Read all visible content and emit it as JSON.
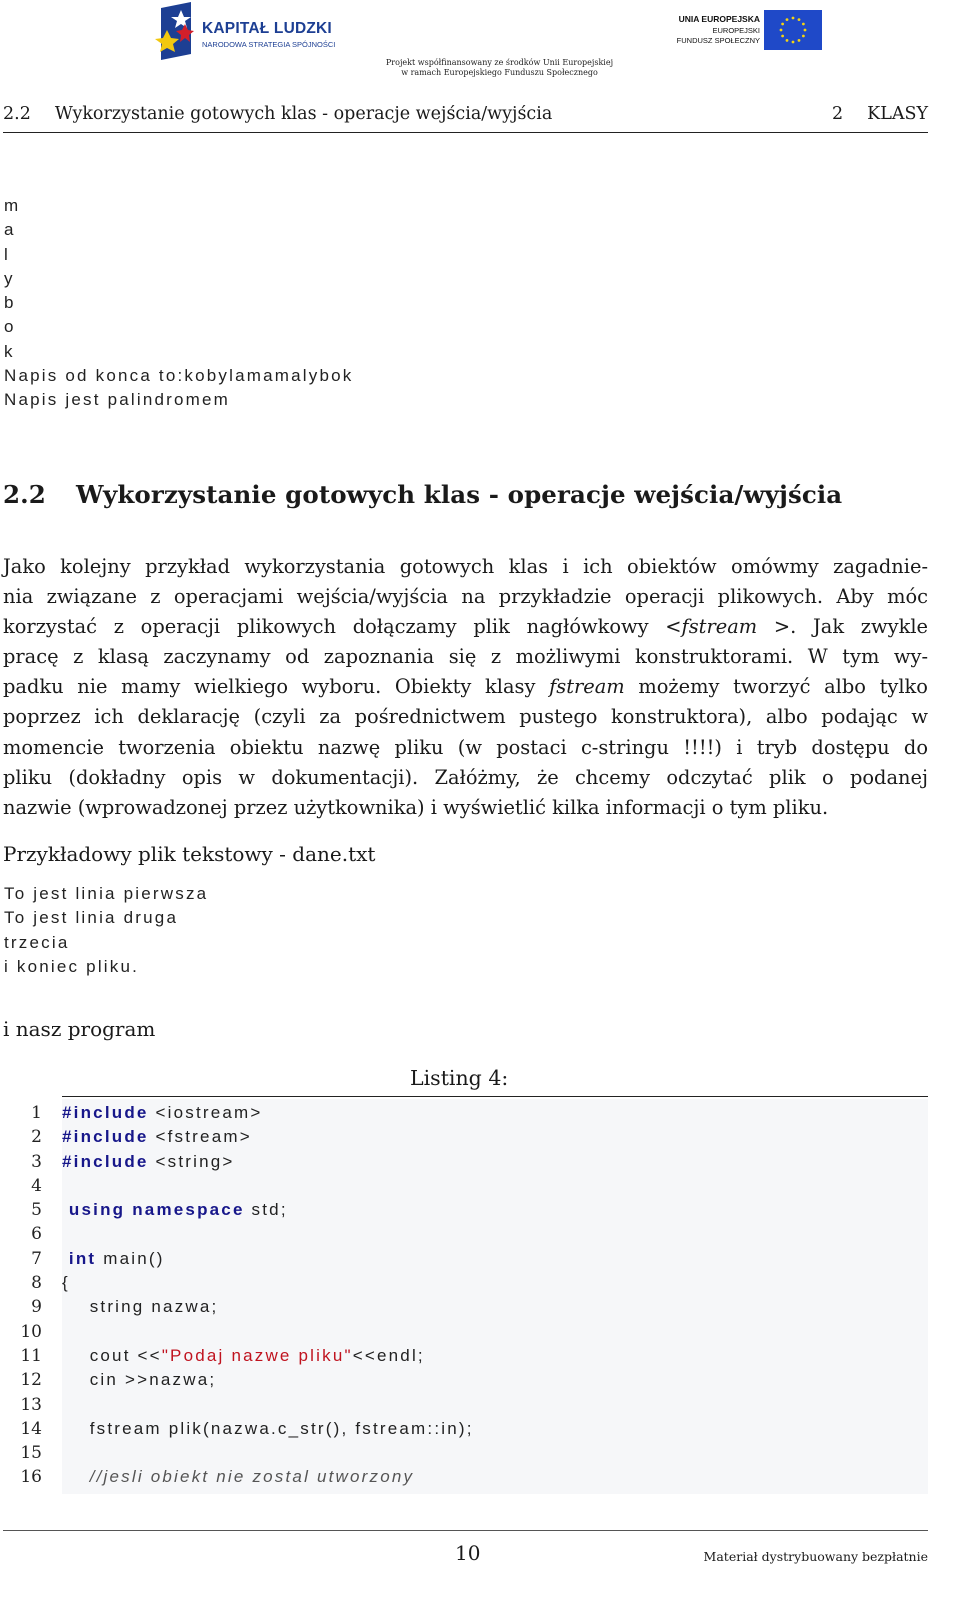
{
  "header": {
    "logo_left": {
      "title": "KAPITAŁ LUDZKI",
      "subtitle": "NARODOWA STRATEGIA SPÓJNOŚCI",
      "colors": {
        "blue": "#1d3f93",
        "white_star": "#ffffff",
        "red_star": "#d21f2a",
        "yellow_star": "#f2c80f"
      }
    },
    "logo_right": {
      "line1": "UNIA EUROPEJSKA",
      "line2": "EUROPEJSKI",
      "line3": "FUNDUSZ SPOŁECZNY",
      "flag_color": "#1f49c8",
      "star_color": "#f4d313"
    },
    "cofinancing": [
      "Projekt współfinansowany ze środków Unii Europejskiej",
      "w ramach Europejskiego Funduszu Społecznego"
    ]
  },
  "running_header": {
    "section_number": "2.2",
    "section_title": "Wykorzystanie gotowych klas - operacje wejścia/wyjścia",
    "chapter_number": "2",
    "chapter_title": "KLASY"
  },
  "previous_output": [
    "m",
    "a",
    "l",
    "y",
    "b",
    "o",
    "k",
    "Napis od konca to:kobylamamalybok",
    "Napis jest palindromem"
  ],
  "section": {
    "number": "2.2",
    "title": "Wykorzystanie gotowych klas - operacje wejścia/wyjścia"
  },
  "paragraph_lines": [
    {
      "text": "Jako kolejny przykład wykorzystania gotowych klas i ich obiektów omówmy zagadnie-"
    },
    {
      "text": "nia związane z operacjami wejścia/wyjścia na przykładzie operacji plikowych. Aby móc"
    },
    {
      "pre": "korzystać z operacji plikowych dołączamy plik nagłówkowy <",
      "em": "fstream",
      "post": " >. Jak zwykle"
    },
    {
      "text": "pracę z klasą zaczynamy od zapoznania się z możliwymi konstruktorami. W tym wy-"
    },
    {
      "pre": "padku nie mamy wielkiego wyboru. Obiekty klasy ",
      "em": "fstream",
      "post": " możemy tworzyć albo tylko"
    },
    {
      "text": "poprzez ich deklarację (czyli za pośrednictwem pustego konstruktora), albo podając w"
    },
    {
      "text": "momencie tworzenia obiektu nazwę pliku (w postaci c-stringu !!!!) i tryb dostępu do"
    },
    {
      "text": "pliku (dokładny opis w dokumentacji). Załóżmy, że chcemy odczytać plik o podanej"
    },
    {
      "text": "nazwie (wprowadzonej przez użytkownika) i wyświetlić kilka informacji o tym pliku."
    }
  ],
  "sample_file": {
    "label": "Przykładowy plik tekstowy - dane.txt",
    "lines": [
      "To jest linia pierwsza",
      "To jest linia druga",
      "trzecia",
      "i koniec pliku."
    ]
  },
  "program_label": "i nasz program",
  "listing": {
    "caption": "Listing 4:",
    "colors": {
      "keyword": "#17178a",
      "string": "#c0131f",
      "comment": "#555555",
      "background": "#f6f7f9"
    },
    "lines": [
      {
        "n": "1",
        "parts": [
          {
            "t": "#include",
            "k": "kw"
          },
          {
            "t": " <iostream>",
            "k": ""
          }
        ]
      },
      {
        "n": "2",
        "parts": [
          {
            "t": "#include",
            "k": "kw"
          },
          {
            "t": " <fstream>",
            "k": ""
          }
        ]
      },
      {
        "n": "3",
        "parts": [
          {
            "t": "#include",
            "k": "kw"
          },
          {
            "t": " <string>",
            "k": ""
          }
        ]
      },
      {
        "n": "4",
        "parts": []
      },
      {
        "n": "5",
        "parts": [
          {
            "t": " using",
            "k": "kw"
          },
          {
            "t": " ",
            "k": ""
          },
          {
            "t": "namespace",
            "k": "kw"
          },
          {
            "t": " std;",
            "k": ""
          }
        ]
      },
      {
        "n": "6",
        "parts": []
      },
      {
        "n": "7",
        "parts": [
          {
            "t": " int",
            "k": "kw"
          },
          {
            "t": " main()",
            "k": ""
          }
        ]
      },
      {
        "n": "8",
        "parts": [
          {
            "t": "{",
            "k": ""
          }
        ]
      },
      {
        "n": "9",
        "parts": [
          {
            "t": "    string nazwa;",
            "k": ""
          }
        ]
      },
      {
        "n": "10",
        "parts": []
      },
      {
        "n": "11",
        "parts": [
          {
            "t": "    cout <<",
            "k": ""
          },
          {
            "t": "\"Podaj nazwe pliku\"",
            "k": "str"
          },
          {
            "t": "<<endl;",
            "k": ""
          }
        ]
      },
      {
        "n": "12",
        "parts": [
          {
            "t": "    cin >>nazwa;",
            "k": ""
          }
        ]
      },
      {
        "n": "13",
        "parts": []
      },
      {
        "n": "14",
        "parts": [
          {
            "t": "    fstream plik(nazwa.c_str(), fstream::in);",
            "k": ""
          }
        ]
      },
      {
        "n": "15",
        "parts": []
      },
      {
        "n": "16",
        "parts": [
          {
            "t": "    //jesli obiekt nie zostal utworzony",
            "k": "com"
          }
        ]
      }
    ]
  },
  "footer": {
    "page_number": "10",
    "note": "Materiał dystrybuowany bezpłatnie"
  }
}
